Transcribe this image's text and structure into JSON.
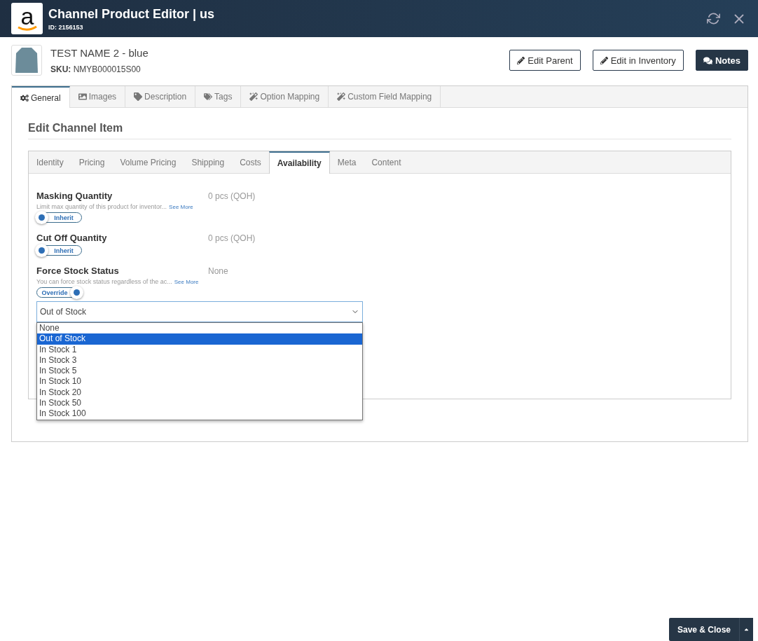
{
  "header": {
    "logo_text": "a",
    "title": "Channel Product Editor | us",
    "id_label": "ID: 2156153"
  },
  "product": {
    "name": "TEST NAME 2 - blue",
    "sku_label": "SKU:",
    "sku": "NMYB000015S00"
  },
  "actions": [
    {
      "label": "Edit Parent",
      "kind": "pencil"
    },
    {
      "label": "Edit in Inventory",
      "kind": "pencil"
    },
    {
      "label": "Notes",
      "kind": "notes"
    }
  ],
  "tabs": [
    {
      "label": "General",
      "kind": "gears",
      "selected": true
    },
    {
      "label": "Images",
      "kind": "image",
      "selected": false
    },
    {
      "label": "Description",
      "kind": "tag",
      "selected": false
    },
    {
      "label": "Tags",
      "kind": "tags",
      "selected": false
    },
    {
      "label": "Option Mapping",
      "kind": "wand",
      "selected": false
    },
    {
      "label": "Custom Field Mapping",
      "kind": "wand",
      "selected": false
    }
  ],
  "section_title": "Edit Channel Item",
  "subtabs": [
    {
      "label": "Identity",
      "selected": false
    },
    {
      "label": "Pricing",
      "selected": false
    },
    {
      "label": "Volume Pricing",
      "selected": false
    },
    {
      "label": "Shipping",
      "selected": false
    },
    {
      "label": "Costs",
      "selected": false
    },
    {
      "label": "Availability",
      "selected": true
    },
    {
      "label": "Meta",
      "selected": false
    },
    {
      "label": "Content",
      "selected": false
    }
  ],
  "fields": [
    {
      "label": "Masking Quantity",
      "value": "0 pcs (QOH)",
      "hint": "Limit max quantity of this product for inventor...",
      "see_more": "See More",
      "toggle_label": "Inherit",
      "on": false
    },
    {
      "label": "Cut Off Quantity",
      "value": "0 pcs (QOH)",
      "toggle_label": "Inherit",
      "on": false
    },
    {
      "label": "Force Stock Status",
      "value": "None",
      "hint": "You can force stock status regardless of the ac...",
      "see_more": "See More",
      "toggle_label": "Override",
      "on": true,
      "select": {
        "value": "Out of Stock",
        "expanded": true,
        "options": [
          {
            "label": "None",
            "selected": false
          },
          {
            "label": "Out of Stock",
            "selected": true
          },
          {
            "label": "In Stock 1",
            "selected": false
          },
          {
            "label": "In Stock 3",
            "selected": false
          },
          {
            "label": "In Stock 5",
            "selected": false
          },
          {
            "label": "In Stock 10",
            "selected": false
          },
          {
            "label": "In Stock 20",
            "selected": false
          },
          {
            "label": "In Stock 50",
            "selected": false
          },
          {
            "label": "In Stock 100",
            "selected": false
          }
        ]
      }
    }
  ],
  "footer": {
    "save_label": "Save & Close"
  }
}
